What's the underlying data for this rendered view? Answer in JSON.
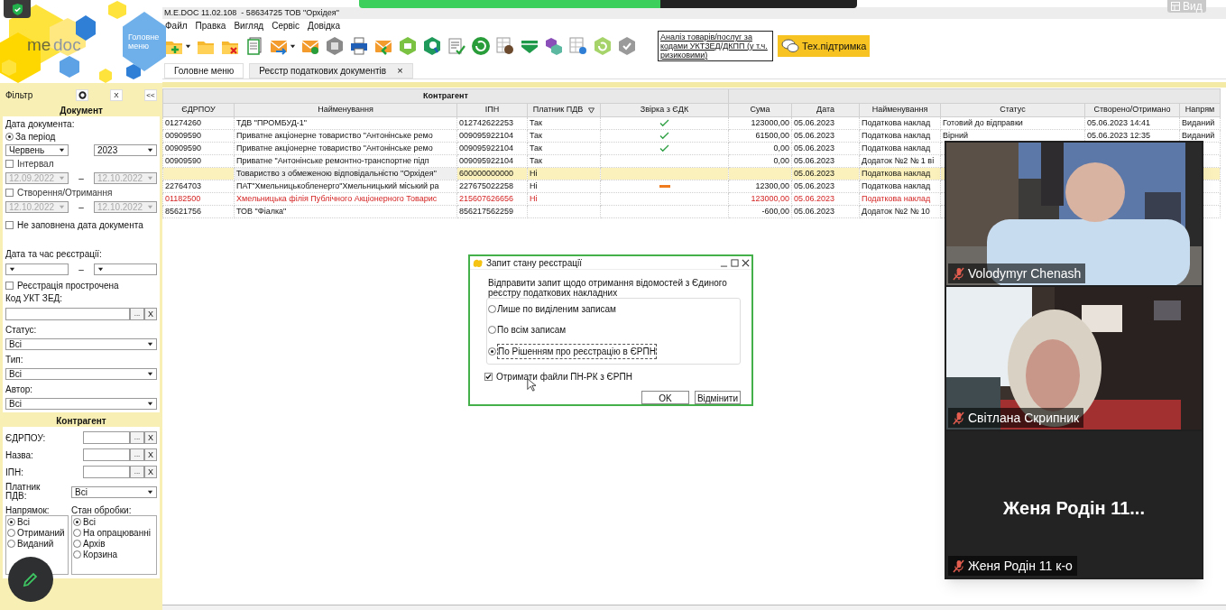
{
  "top_button": "Вид",
  "logo": {
    "part_1": "me",
    "part_2": "doc",
    "main_menu": "Головне меню"
  },
  "window": {
    "title": "M.E.DOC 11.02.108  - 58634725 ТОВ \"Орхідея\""
  },
  "menu": [
    "Файл",
    "Правка",
    "Вигляд",
    "Сервіс",
    "Довідка"
  ],
  "analysis_link": "Аналіз товарів/послуг за кодами УКТЗЕД/ДКПП (у т.ч. ризиковими)",
  "support_button": "Тех.підтримка",
  "tabs": [
    {
      "label": "Головне меню",
      "selected": false
    },
    {
      "label": "Реєстр податкових документів",
      "selected": true,
      "close": "×"
    }
  ],
  "filter": {
    "title": "Фільтр",
    "clear": "X",
    "collapse": "<<",
    "document": {
      "heading": "Документ",
      "date_label": "Дата документа:",
      "period": {
        "label": "За період",
        "selected": true,
        "month": "Червень",
        "year": "2023"
      },
      "interval": {
        "label": "Інтервал",
        "checked": false,
        "from": "12.09.2022",
        "separator": "–",
        "to": "12.10.2022"
      },
      "created": {
        "label": "Створення/Отримання",
        "checked": false,
        "from": "12.10.2022",
        "separator": "–",
        "to": "12.10.2022"
      },
      "no_date": {
        "label": "Не заповнена дата документа",
        "checked": false
      },
      "registration_label": "Дата та час реєстрації:",
      "registration_separator": "–",
      "overdue": {
        "label": "Реєстрація прострочена",
        "checked": false
      },
      "code": {
        "label": "Код УКТ ЗЕД:",
        "browse": "...",
        "clear": "X"
      },
      "selects": [
        {
          "label": "Статус:",
          "value": "Всі"
        },
        {
          "label": "Тип:",
          "value": "Всі"
        },
        {
          "label": "Автор:",
          "value": "Всі"
        }
      ]
    },
    "counterparty": {
      "heading": "Контрагент",
      "fields": [
        {
          "label": "ЄДРПОУ:",
          "browse": "...",
          "clear": "X"
        },
        {
          "label": "Назва:",
          "browse": "...",
          "clear": "X"
        },
        {
          "label": "ІПН:",
          "browse": "...",
          "clear": "X"
        }
      ],
      "vat": {
        "label": "Платник ПДВ:",
        "value": "Всі"
      },
      "direction": {
        "label": "Напрямок:",
        "options": [
          {
            "label": "Всі",
            "selected": true
          },
          {
            "label": "Отриманий",
            "selected": false
          },
          {
            "label": "Виданий",
            "selected": false
          }
        ]
      },
      "processing": {
        "label": "Стан обробки:",
        "options": [
          {
            "label": "Всі",
            "selected": true
          },
          {
            "label": "На опрацюванні",
            "selected": false
          },
          {
            "label": "Архів",
            "selected": false
          },
          {
            "label": "Корзина",
            "selected": false
          }
        ]
      }
    }
  },
  "table": {
    "group_header": "Контрагент",
    "columns": [
      "ЄДРПОУ",
      "Найменування",
      "ІПН",
      "Платник ПДВ",
      "Звірка з ЄДК",
      "Сума",
      "Дата",
      "Найменування",
      "Статус",
      "Створено/Отримано",
      "Напрям"
    ],
    "rows": [
      {
        "edrpou": "01274260",
        "name": "ТДВ \"ПРОМБУД-1\"",
        "ipn": "012742622253",
        "vat": "Так",
        "reconciliation": {
          "kind": "match"
        },
        "sum": "123000,00",
        "date": "05.06.2023",
        "doc": "Податкова наклад",
        "status": "Готовий до відправки",
        "created": "05.06.2023 14:41",
        "direction": "Виданий",
        "selected": false,
        "error": false
      },
      {
        "edrpou": "00909590",
        "name": "Приватне акціонерне товариство \"Антонінське ремо",
        "ipn": "009095922104",
        "vat": "Так",
        "reconciliation": {
          "kind": "match"
        },
        "sum": "61500,00",
        "date": "05.06.2023",
        "doc": "Податкова наклад",
        "status": "Вірний",
        "created": "05.06.2023 12:35",
        "direction": "Виданий",
        "selected": false,
        "error": false
      },
      {
        "edrpou": "00909590",
        "name": "Приватне акціонерне товариство \"Антонінське ремо",
        "ipn": "009095922104",
        "vat": "Так",
        "reconciliation": {
          "kind": "match"
        },
        "sum": "0,00",
        "date": "05.06.2023",
        "doc": "Податкова наклад",
        "selected": false,
        "error": false
      },
      {
        "edrpou": "00909590",
        "name": "Приватне  \"Антонінське ремонтно-транспортне підп",
        "ipn": "009095922104",
        "vat": "Так",
        "sum": "0,00",
        "date": "05.06.2023",
        "doc": "Додаток №2 № 1 ві",
        "selected": false,
        "error": false
      },
      {
        "name": "Товариство з обмеженою відповідальністю \"Орхідея\"",
        "ipn": "600000000000",
        "vat": "Ні",
        "date": "05.06.2023",
        "doc": "Податкова наклад",
        "selected": true,
        "error": false
      },
      {
        "edrpou": "22764703",
        "name": "ПАТ\"Хмельницькобленерго\"Хмельницький міський ра",
        "ipn": "227675022258",
        "vat": "Ні",
        "reconciliation": {
          "kind": "mismatch"
        },
        "sum": "12300,00",
        "date": "05.06.2023",
        "doc": "Податкова наклад",
        "selected": false,
        "error": false
      },
      {
        "edrpou": "01182500",
        "name": "Хмельницька філія Публічного Акціонерного Товарис",
        "ipn": "215607626656",
        "vat": "Ні",
        "sum": "123000,00",
        "date": "05.06.2023",
        "doc": "Податкова наклад",
        "selected": false,
        "error": true
      },
      {
        "edrpou": "85621756",
        "name": "ТОВ \"Фіалка\"",
        "ipn": "856217562259",
        "sum": "-600,00",
        "date": "05.06.2023",
        "doc": "Додаток №2 № 10",
        "selected": false,
        "error": false
      }
    ]
  },
  "dialog": {
    "title": "Запит стану реєстрації",
    "prompt": "Відправити запит щодо отримання відомостей з Єдиного реєстру податкових накладних",
    "options": [
      {
        "label": "Лише по виділеним записам",
        "selected": false
      },
      {
        "label": "По всім записам",
        "selected": false
      },
      {
        "label": "По Рішенням про реєстрацію в ЄРПН",
        "selected": true
      }
    ],
    "files": {
      "label": "Отримати файли ПН-РК з ЄРПН",
      "checked": true
    },
    "buttons": [
      "OK",
      "Відмінити"
    ]
  },
  "video_call": {
    "tiles": [
      {
        "kind": "video",
        "name": "Volodymyr Chenash",
        "muted": true
      },
      {
        "kind": "video",
        "name": "Світлана Скрипник",
        "muted": true
      },
      {
        "kind": "avatar",
        "display": "Женя Родін 11...",
        "name": "Женя Родін 11 к-о",
        "muted": true
      }
    ]
  }
}
